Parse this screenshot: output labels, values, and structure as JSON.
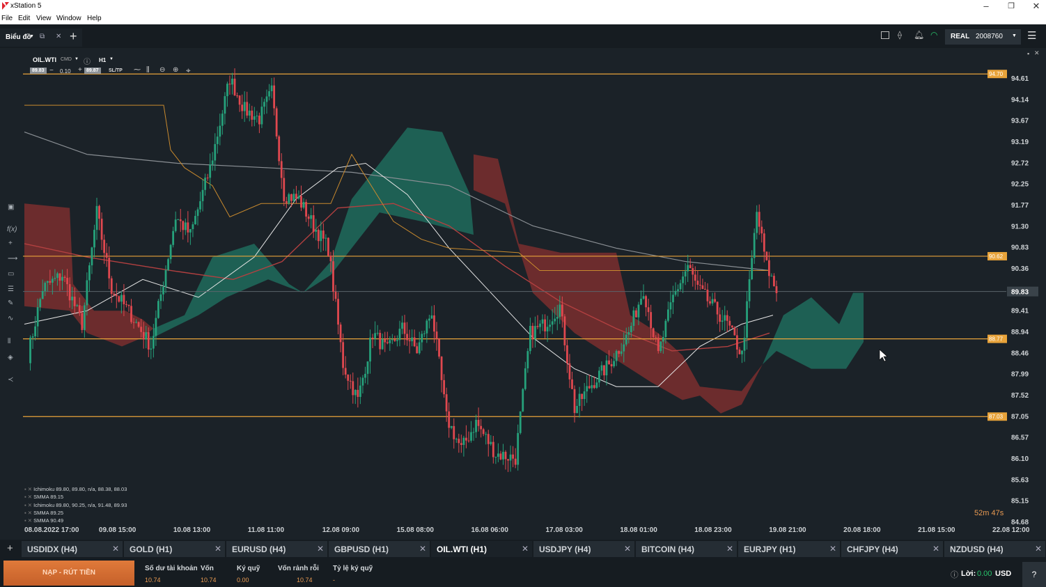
{
  "window": {
    "title": "xStation 5"
  },
  "menu": [
    "File",
    "Edit",
    "View",
    "Window",
    "Help"
  ],
  "toolbar": {
    "tab_label": "Biểu đồ",
    "account_type": "REAL",
    "account_number": "2008760"
  },
  "chart": {
    "symbol": "OIL.WTI",
    "symbol_type": "CMD",
    "timeframe": "H1",
    "sell_price": "89.83",
    "volume": "0.10",
    "buy_price": "89.87",
    "sltp": "SL/TP",
    "countdown": "52m 47s",
    "legend": [
      "Ichimoku 89.80, 89.80, n/a, 88.38, 88.03",
      "SMMA 89.15",
      "Ichimoku 89.80, 90.25, n/a, 91.48, 89.93",
      "SMMA 89.25",
      "SMMA 90.49"
    ]
  },
  "chart_data": {
    "type": "candlestick",
    "y_ticks": [
      "94.61",
      "94.14",
      "93.67",
      "93.19",
      "92.72",
      "92.25",
      "91.77",
      "91.30",
      "90.83",
      "90.36",
      "89.83",
      "89.41",
      "88.94",
      "88.46",
      "87.99",
      "87.52",
      "87.05",
      "86.57",
      "86.10",
      "85.63",
      "85.15",
      "84.68"
    ],
    "x_ticks": [
      "08.08.2022 17:00",
      "09.08 15:00",
      "10.08 13:00",
      "11.08 11:00",
      "12.08 09:00",
      "15.08 08:00",
      "16.08 06:00",
      "17.08 03:00",
      "18.08 01:00",
      "18.08 23:00",
      "19.08 21:00",
      "20.08 18:00",
      "21.08 15:00",
      "22.08 12:00"
    ],
    "ylim": [
      84.68,
      94.61
    ],
    "current_price": "89.83",
    "horizontal_levels": [
      {
        "label": "94.70",
        "price": 94.7
      },
      {
        "label": "90.62",
        "price": 90.62
      },
      {
        "label": "88.77",
        "price": 88.77
      },
      {
        "label": "87.03",
        "price": 87.03
      }
    ],
    "colors": {
      "up": "#26a17b",
      "down": "#e0484f",
      "level": "#e8a33a",
      "cloud_up": "#1f6b5c",
      "cloud_down": "#7a2e2e"
    }
  },
  "tabs": [
    {
      "label": "USDIDX (H4)"
    },
    {
      "label": "GOLD (H1)"
    },
    {
      "label": "EURUSD (H4)"
    },
    {
      "label": "GBPUSD (H1)"
    },
    {
      "label": "OIL.WTI (H1)",
      "active": true
    },
    {
      "label": "USDJPY (H4)"
    },
    {
      "label": "BITCOIN (H4)"
    },
    {
      "label": "EURJPY (H1)"
    },
    {
      "label": "CHFJPY (H4)"
    },
    {
      "label": "NZDUSD (H4)"
    }
  ],
  "bottom": {
    "deposit_button": "NẠP - RÚT TIỀN",
    "balance_label": "Số dư tài khoản",
    "balance_value": "10.74",
    "equity_label": "Vốn",
    "equity_value": "10.74",
    "margin_label": "Ký quỹ",
    "margin_value": "0.00",
    "free_label": "Vốn rảnh rỗi",
    "free_value": "10.74",
    "margin_level_label": "Tỷ lệ ký quỹ",
    "margin_level_value": "-",
    "profit_label": "Lời:",
    "profit_value": "0.00",
    "currency": "USD"
  }
}
